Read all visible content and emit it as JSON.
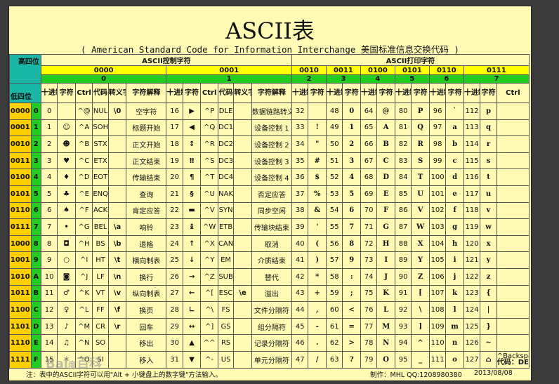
{
  "title": "ASCII表",
  "subtitle": "( American Standard Code for Information Interchange  美国标准信息交换代码 )",
  "header": {
    "high_bits": "高四位",
    "low_bits": "低四位",
    "control_group": "ASCII控制字符",
    "print_group": "ASCII打印字符",
    "control_cols": [
      "十进制",
      "字符",
      "Ctrl",
      "代码",
      "转义字符",
      "字符解释"
    ],
    "print_cols": [
      "十进制",
      "字符"
    ],
    "ctrl_label": "Ctrl",
    "high_bits_values": [
      "0000",
      "0001",
      "0010",
      "0011",
      "0100",
      "0101",
      "0110",
      "0111"
    ],
    "high_nums": [
      "0",
      "1",
      "2",
      "3",
      "4",
      "5",
      "6",
      "7"
    ]
  },
  "rows": [
    {
      "bin": "0000",
      "hex": "0",
      "c0": {
        "dec": "0",
        "ch": "",
        "ctrl": "^@",
        "abbr": "NUL",
        "esc": "\\0",
        "desc": "空字符"
      },
      "c1": {
        "dec": "16",
        "ch": "▶",
        "ctrl": "^P",
        "abbr": "DLE",
        "esc": "",
        "desc": "数据链路转义"
      },
      "p": [
        [
          "32",
          ""
        ],
        [
          "48",
          "0"
        ],
        [
          "64",
          "@"
        ],
        [
          "80",
          "P"
        ],
        [
          "96",
          "`"
        ],
        [
          "112",
          "p"
        ]
      ]
    },
    {
      "bin": "0001",
      "hex": "1",
      "c0": {
        "dec": "1",
        "ch": "☺",
        "ctrl": "^A",
        "abbr": "SOH",
        "esc": "",
        "desc": "标题开始"
      },
      "c1": {
        "dec": "17",
        "ch": "◀",
        "ctrl": "^Q",
        "abbr": "DC1",
        "esc": "",
        "desc": "设备控制 1"
      },
      "p": [
        [
          "33",
          "!"
        ],
        [
          "49",
          "1"
        ],
        [
          "65",
          "A"
        ],
        [
          "81",
          "Q"
        ],
        [
          "97",
          "a"
        ],
        [
          "113",
          "q"
        ]
      ]
    },
    {
      "bin": "0010",
      "hex": "2",
      "c0": {
        "dec": "2",
        "ch": "☻",
        "ctrl": "^B",
        "abbr": "STX",
        "esc": "",
        "desc": "正文开始"
      },
      "c1": {
        "dec": "18",
        "ch": "↕",
        "ctrl": "^R",
        "abbr": "DC2",
        "esc": "",
        "desc": "设备控制 2"
      },
      "p": [
        [
          "34",
          "\""
        ],
        [
          "50",
          "2"
        ],
        [
          "66",
          "B"
        ],
        [
          "82",
          "R"
        ],
        [
          "98",
          "b"
        ],
        [
          "114",
          "r"
        ]
      ]
    },
    {
      "bin": "0011",
      "hex": "3",
      "c0": {
        "dec": "3",
        "ch": "♥",
        "ctrl": "^C",
        "abbr": "ETX",
        "esc": "",
        "desc": "正文结束"
      },
      "c1": {
        "dec": "19",
        "ch": "‼",
        "ctrl": "^S",
        "abbr": "DC3",
        "esc": "",
        "desc": "设备控制 3"
      },
      "p": [
        [
          "35",
          "#"
        ],
        [
          "51",
          "3"
        ],
        [
          "67",
          "C"
        ],
        [
          "83",
          "S"
        ],
        [
          "99",
          "c"
        ],
        [
          "115",
          "s"
        ]
      ]
    },
    {
      "bin": "0100",
      "hex": "4",
      "c0": {
        "dec": "4",
        "ch": "♦",
        "ctrl": "^D",
        "abbr": "EOT",
        "esc": "",
        "desc": "传输结束"
      },
      "c1": {
        "dec": "20",
        "ch": "¶",
        "ctrl": "^T",
        "abbr": "DC4",
        "esc": "",
        "desc": "设备控制 4"
      },
      "p": [
        [
          "36",
          "$"
        ],
        [
          "52",
          "4"
        ],
        [
          "68",
          "D"
        ],
        [
          "84",
          "T"
        ],
        [
          "100",
          "d"
        ],
        [
          "116",
          "t"
        ]
      ]
    },
    {
      "bin": "0101",
      "hex": "5",
      "c0": {
        "dec": "5",
        "ch": "♣",
        "ctrl": "^E",
        "abbr": "ENQ",
        "esc": "",
        "desc": "查询"
      },
      "c1": {
        "dec": "21",
        "ch": "§",
        "ctrl": "^U",
        "abbr": "NAK",
        "esc": "",
        "desc": "否定应答"
      },
      "p": [
        [
          "37",
          "%"
        ],
        [
          "53",
          "5"
        ],
        [
          "69",
          "E"
        ],
        [
          "85",
          "U"
        ],
        [
          "101",
          "e"
        ],
        [
          "117",
          "u"
        ]
      ]
    },
    {
      "bin": "0110",
      "hex": "6",
      "c0": {
        "dec": "6",
        "ch": "♠",
        "ctrl": "^F",
        "abbr": "ACK",
        "esc": "",
        "desc": "肯定应答"
      },
      "c1": {
        "dec": "22",
        "ch": "▬",
        "ctrl": "^V",
        "abbr": "SYN",
        "esc": "",
        "desc": "同步空闲"
      },
      "p": [
        [
          "38",
          "&"
        ],
        [
          "54",
          "6"
        ],
        [
          "70",
          "F"
        ],
        [
          "86",
          "V"
        ],
        [
          "102",
          "f"
        ],
        [
          "118",
          "v"
        ]
      ]
    },
    {
      "bin": "0111",
      "hex": "7",
      "c0": {
        "dec": "7",
        "ch": "•",
        "ctrl": "^G",
        "abbr": "BEL",
        "esc": "\\a",
        "desc": "响铃"
      },
      "c1": {
        "dec": "23",
        "ch": "↨",
        "ctrl": "^W",
        "abbr": "ETB",
        "esc": "",
        "desc": "传输块结束"
      },
      "p": [
        [
          "39",
          "'"
        ],
        [
          "55",
          "7"
        ],
        [
          "71",
          "G"
        ],
        [
          "87",
          "W"
        ],
        [
          "103",
          "g"
        ],
        [
          "119",
          "w"
        ]
      ]
    },
    {
      "bin": "1000",
      "hex": "8",
      "c0": {
        "dec": "8",
        "ch": "◘",
        "ctrl": "^H",
        "abbr": "BS",
        "esc": "\\b",
        "desc": "退格"
      },
      "c1": {
        "dec": "24",
        "ch": "↑",
        "ctrl": "^X",
        "abbr": "CAN",
        "esc": "",
        "desc": "取消"
      },
      "p": [
        [
          "40",
          "("
        ],
        [
          "56",
          "8"
        ],
        [
          "72",
          "H"
        ],
        [
          "88",
          "X"
        ],
        [
          "104",
          "h"
        ],
        [
          "120",
          "x"
        ]
      ]
    },
    {
      "bin": "1001",
      "hex": "9",
      "c0": {
        "dec": "9",
        "ch": "○",
        "ctrl": "^I",
        "abbr": "HT",
        "esc": "\\t",
        "desc": "横向制表"
      },
      "c1": {
        "dec": "25",
        "ch": "↓",
        "ctrl": "^Y",
        "abbr": "EM",
        "esc": "",
        "desc": "介质结束"
      },
      "p": [
        [
          "41",
          ")"
        ],
        [
          "57",
          "9"
        ],
        [
          "73",
          "I"
        ],
        [
          "89",
          "Y"
        ],
        [
          "105",
          "i"
        ],
        [
          "121",
          "y"
        ]
      ]
    },
    {
      "bin": "1010",
      "hex": "A",
      "c0": {
        "dec": "10",
        "ch": "◙",
        "ctrl": "^J",
        "abbr": "LF",
        "esc": "\\n",
        "desc": "换行"
      },
      "c1": {
        "dec": "26",
        "ch": "→",
        "ctrl": "^Z",
        "abbr": "SUB",
        "esc": "",
        "desc": "替代"
      },
      "p": [
        [
          "42",
          "*"
        ],
        [
          "58",
          ":"
        ],
        [
          "74",
          "J"
        ],
        [
          "90",
          "Z"
        ],
        [
          "106",
          "j"
        ],
        [
          "122",
          "z"
        ]
      ]
    },
    {
      "bin": "1011",
      "hex": "B",
      "c0": {
        "dec": "11",
        "ch": "♂",
        "ctrl": "^K",
        "abbr": "VT",
        "esc": "\\v",
        "desc": "纵向制表"
      },
      "c1": {
        "dec": "27",
        "ch": "←",
        "ctrl": "^[",
        "abbr": "ESC",
        "esc": "\\e",
        "desc": "溢出"
      },
      "p": [
        [
          "43",
          "+"
        ],
        [
          "59",
          ";"
        ],
        [
          "75",
          "K"
        ],
        [
          "91",
          "["
        ],
        [
          "107",
          "k"
        ],
        [
          "123",
          "{"
        ]
      ]
    },
    {
      "bin": "1100",
      "hex": "C",
      "c0": {
        "dec": "12",
        "ch": "♀",
        "ctrl": "^L",
        "abbr": "FF",
        "esc": "\\f",
        "desc": "换页"
      },
      "c1": {
        "dec": "28",
        "ch": "∟",
        "ctrl": "^\\",
        "abbr": "FS",
        "esc": "",
        "desc": "文件分隔符"
      },
      "p": [
        [
          "44",
          ","
        ],
        [
          "60",
          "<"
        ],
        [
          "76",
          "L"
        ],
        [
          "92",
          "\\"
        ],
        [
          "108",
          "l"
        ],
        [
          "124",
          "|"
        ]
      ]
    },
    {
      "bin": "1101",
      "hex": "D",
      "c0": {
        "dec": "13",
        "ch": "♪",
        "ctrl": "^M",
        "abbr": "CR",
        "esc": "\\r",
        "desc": "回车"
      },
      "c1": {
        "dec": "29",
        "ch": "↔",
        "ctrl": "^]",
        "abbr": "GS",
        "esc": "",
        "desc": "组分隔符"
      },
      "p": [
        [
          "45",
          "-"
        ],
        [
          "61",
          "="
        ],
        [
          "77",
          "M"
        ],
        [
          "93",
          "]"
        ],
        [
          "109",
          "m"
        ],
        [
          "125",
          "}"
        ]
      ]
    },
    {
      "bin": "1110",
      "hex": "E",
      "c0": {
        "dec": "14",
        "ch": "♫",
        "ctrl": "^N",
        "abbr": "SO",
        "esc": "",
        "desc": "移出"
      },
      "c1": {
        "dec": "30",
        "ch": "▲",
        "ctrl": "^^",
        "abbr": "RS",
        "esc": "",
        "desc": "记录分隔符"
      },
      "p": [
        [
          "46",
          "."
        ],
        [
          "62",
          ">"
        ],
        [
          "78",
          "N"
        ],
        [
          "94",
          "^"
        ],
        [
          "110",
          "n"
        ],
        [
          "126",
          "~"
        ]
      ]
    },
    {
      "bin": "1111",
      "hex": "F",
      "c0": {
        "dec": "15",
        "ch": "☼",
        "ctrl": "^O",
        "abbr": "SI",
        "esc": "",
        "desc": "移入"
      },
      "c1": {
        "dec": "31",
        "ch": "▼",
        "ctrl": "^-",
        "abbr": "US",
        "esc": "",
        "desc": "单元分隔符"
      },
      "p": [
        [
          "47",
          "/"
        ],
        [
          "63",
          "?"
        ],
        [
          "79",
          "O"
        ],
        [
          "95",
          "_"
        ],
        [
          "111",
          "o"
        ],
        [
          "127",
          "⌂"
        ]
      ]
    }
  ],
  "last_cell": {
    "line1": "^Backspace",
    "line2": "代码：DEL"
  },
  "footer": {
    "note": "注：表中的ASCII字符可以用\"Alt + 小键盘上的数字键\"方法输入。",
    "author": "制作：MHL  QQ:1208980380",
    "date": "2013/08/08"
  },
  "watermark": "Bai度百科",
  "colors": {
    "background": "#fffbb4",
    "header_teal": "#1ab6a6",
    "bits_yellow": "#ffff00",
    "num_green": "#22cc22",
    "row_orange": "#ffd000",
    "column_header_blue": "#0033cc"
  }
}
